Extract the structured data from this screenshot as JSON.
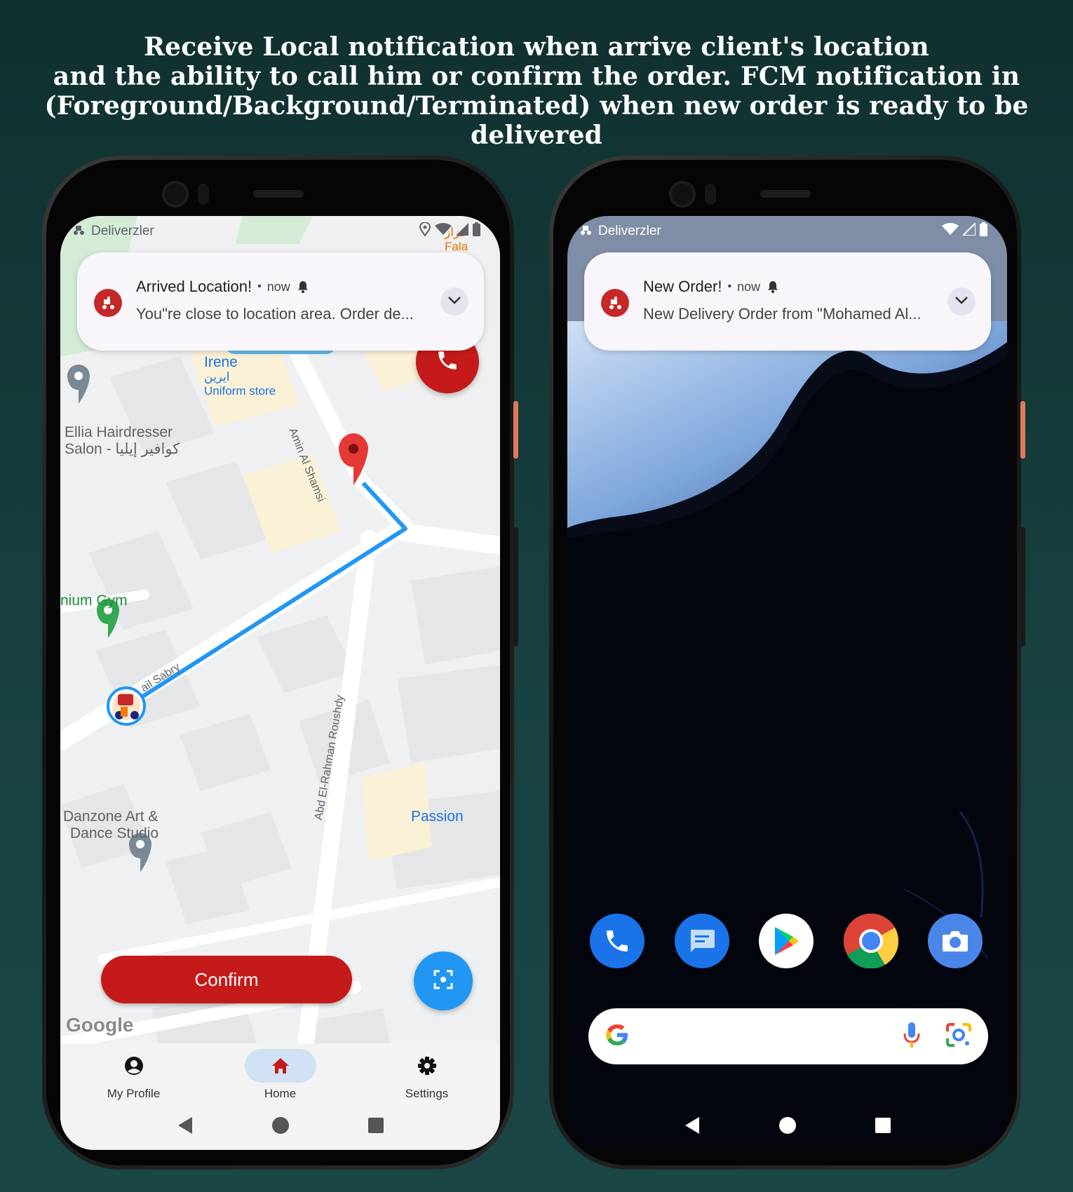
{
  "headline": {
    "line1": "Receive Local notification when arrive client's location",
    "line2": "and the ability to call him or confirm the order. FCM notification in",
    "line3": "(Foreground/Background/Terminated) when new order is ready to be delivered"
  },
  "colors": {
    "background": "#133a3a",
    "brand_red": "#c41a1a",
    "fab_blue": "#2196f3",
    "route_blue": "#2196f3"
  },
  "left_phone": {
    "status_bar": {
      "app_name": "Deliverzler",
      "icons": [
        "location-icon",
        "wifi-icon",
        "signal-icon",
        "battery-icon"
      ]
    },
    "notification": {
      "title": "Arrived Location!",
      "time": "now",
      "body": "You\"re close to location area. Order de..."
    },
    "map": {
      "places": {
        "irene": "Irene",
        "irene_ar": "ايرين",
        "irene_type": "Uniform store",
        "ellia_line1": "Ellia Hairdresser",
        "ellia_line2": "Salon - كوافير إيليا",
        "gym": "nium Gym",
        "danzone_line1": "Danzone Art &",
        "danzone_line2": "Dance Studio",
        "passion": "Passion",
        "corner_ar": "قزاز",
        "corner_en": "Fala"
      },
      "streets": {
        "amin": "Amin Al Shamsi",
        "sabry": "ail Sabry",
        "abd": "Abd El-Rahman Roushdy"
      },
      "attribution": "Google"
    },
    "confirm_label": "Confirm",
    "bottom_nav": [
      {
        "label": "My Profile",
        "icon": "account-circle-icon"
      },
      {
        "label": "Home",
        "icon": "home-icon",
        "active": true
      },
      {
        "label": "Settings",
        "icon": "gear-icon"
      }
    ]
  },
  "right_phone": {
    "status_bar": {
      "app_name": "Deliverzler",
      "icons": [
        "wifi-icon",
        "signal-icon",
        "battery-icon"
      ]
    },
    "notification": {
      "title": "New Order!",
      "time": "now",
      "body": "New Delivery Order from \"Mohamed Al..."
    },
    "dock": [
      "phone-app-icon",
      "messages-app-icon",
      "play-store-icon",
      "chrome-icon",
      "camera-app-icon"
    ],
    "search": {
      "logo": "G"
    }
  }
}
